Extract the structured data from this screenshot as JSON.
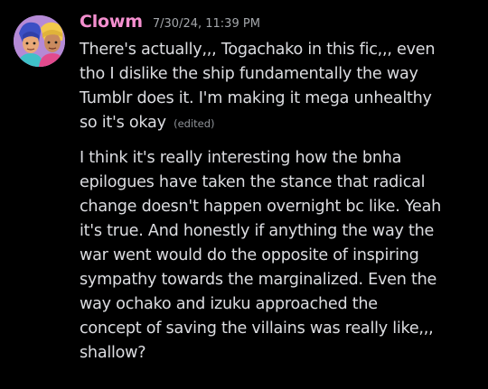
{
  "author": {
    "name": "Clowm",
    "name_color": "#f48fcf"
  },
  "timestamp": "7/30/24, 11:39 PM",
  "messages": [
    {
      "lines": [
        "There's actually,,, Togachako in this fic,,, even",
        "tho I dislike the ship fundamentally the way",
        "Tumblr does it. I'm making it mega unhealthy",
        "so it's okay"
      ],
      "edited_label": "(edited)"
    },
    {
      "lines": [
        "I think it's really interesting how the bnha",
        "epilogues have taken the stance that radical",
        "change doesn't happen overnight bc like. Yeah",
        "it's true. And honestly if anything the way the",
        "war went would do the opposite of inspiring",
        "sympathy towards the marginalized. Even the",
        "way ochako and izuku approached the",
        "concept of saving the villains was really like,,,",
        "shallow?"
      ]
    }
  ],
  "colors": {
    "background": "#000000",
    "text": "#dcdde1",
    "timestamp": "#a3a6aa",
    "edited": "#8e9297",
    "avatar_bg": "#b58ad6"
  }
}
